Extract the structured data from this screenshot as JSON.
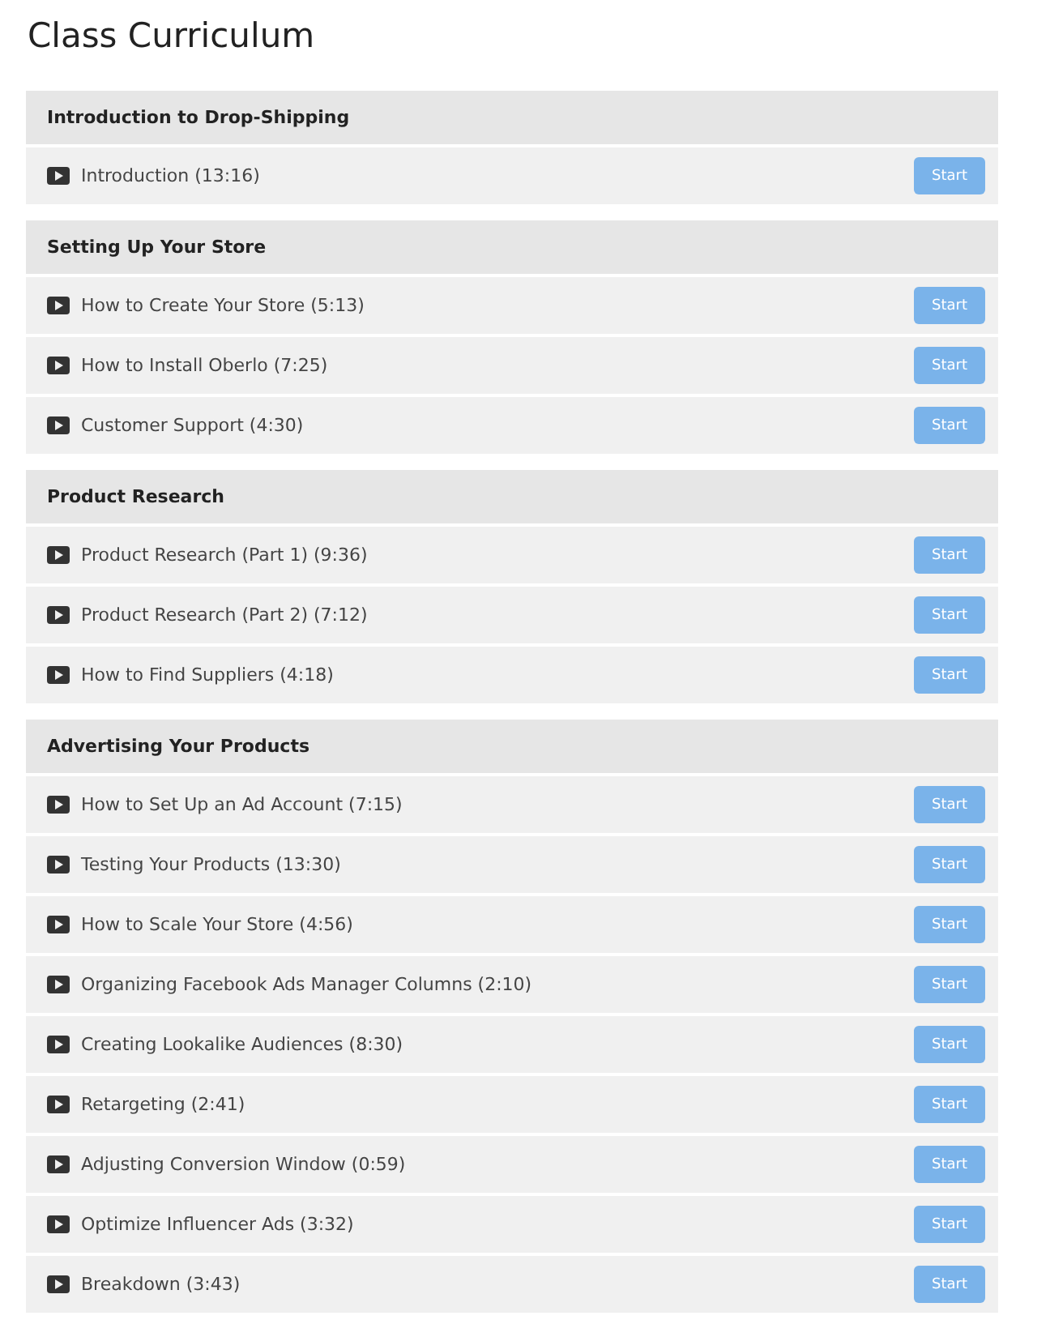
{
  "title": "Class Curriculum",
  "sections": [
    {
      "title": "Introduction to Drop-Shipping",
      "lessons": [
        {
          "label": "Introduction (13:16)",
          "button": "Start"
        }
      ]
    },
    {
      "title": "Setting Up Your Store",
      "lessons": [
        {
          "label": "How to Create Your Store (5:13)",
          "button": "Start"
        },
        {
          "label": "How to Install Oberlo (7:25)",
          "button": "Start"
        },
        {
          "label": "Customer Support (4:30)",
          "button": "Start"
        }
      ]
    },
    {
      "title": "Product Research",
      "lessons": [
        {
          "label": "Product Research (Part 1) (9:36)",
          "button": "Start"
        },
        {
          "label": "Product Research (Part 2) (7:12)",
          "button": "Start"
        },
        {
          "label": "How to Find Suppliers (4:18)",
          "button": "Start"
        }
      ]
    },
    {
      "title": "Advertising Your Products",
      "lessons": [
        {
          "label": "How to Set Up an Ad Account (7:15)",
          "button": "Start"
        },
        {
          "label": "Testing Your Products (13:30)",
          "button": "Start"
        },
        {
          "label": "How to Scale Your Store (4:56)",
          "button": "Start"
        },
        {
          "label": "Organizing Facebook Ads Manager Columns (2:10)",
          "button": "Start"
        },
        {
          "label": "Creating Lookalike Audiences (8:30)",
          "button": "Start"
        },
        {
          "label": "Retargeting (2:41)",
          "button": "Start"
        },
        {
          "label": "Adjusting Conversion Window (0:59)",
          "button": "Start"
        },
        {
          "label": "Optimize Influencer Ads (3:32)",
          "button": "Start"
        },
        {
          "label": "Breakdown (3:43)",
          "button": "Start"
        }
      ]
    }
  ]
}
